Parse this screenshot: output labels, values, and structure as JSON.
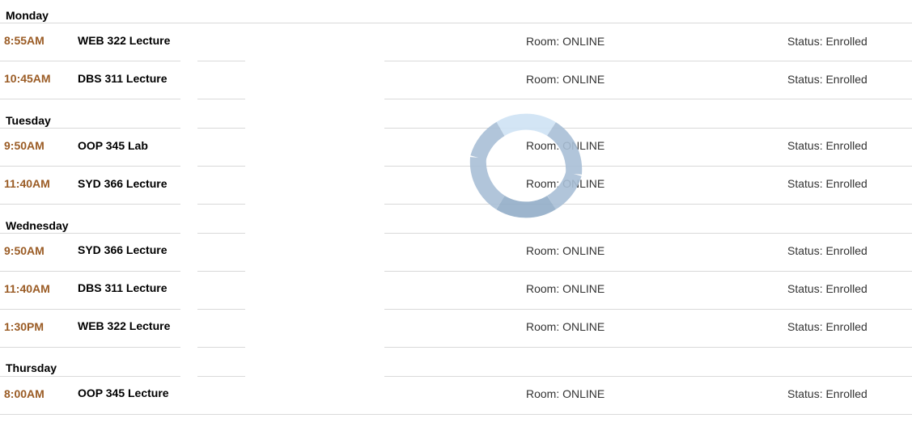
{
  "schedule": {
    "days": [
      {
        "name": "Monday",
        "classes": [
          {
            "time": "8:55AM",
            "course": "WEB 322 Lecture",
            "room": "Room: ONLINE",
            "status": "Status: Enrolled"
          },
          {
            "time": "10:45AM",
            "course": "DBS 311 Lecture",
            "room": "Room: ONLINE",
            "status": "Status: Enrolled"
          }
        ]
      },
      {
        "name": "Tuesday",
        "classes": [
          {
            "time": "9:50AM",
            "course": "OOP 345 Lab",
            "room": "Room: ONLINE",
            "status": "Status: Enrolled"
          },
          {
            "time": "11:40AM",
            "course": "SYD 366 Lecture",
            "room": "Room: ONLINE",
            "status": "Status: Enrolled"
          }
        ]
      },
      {
        "name": "Wednesday",
        "classes": [
          {
            "time": "9:50AM",
            "course": "SYD 366 Lecture",
            "room": "Room: ONLINE",
            "status": "Status: Enrolled"
          },
          {
            "time": "11:40AM",
            "course": "DBS 311 Lecture",
            "room": "Room: ONLINE",
            "status": "Status: Enrolled"
          },
          {
            "time": "1:30PM",
            "course": "WEB 322 Lecture",
            "room": "Room: ONLINE",
            "status": "Status: Enrolled"
          }
        ]
      },
      {
        "name": "Thursday",
        "classes": [
          {
            "time": "8:00AM",
            "course": "OOP 345 Lecture",
            "room": "Room: ONLINE",
            "status": "Status: Enrolled"
          }
        ]
      }
    ]
  },
  "loading_indicator": {
    "icon": "loading-spinner-icon"
  },
  "colors": {
    "time_text": "#9a5b24",
    "divider": "#d9d9d9",
    "spinner_light": "#cfe3f4",
    "spinner_mid": "#a9bfd6",
    "spinner_dark": "#93aec8"
  }
}
